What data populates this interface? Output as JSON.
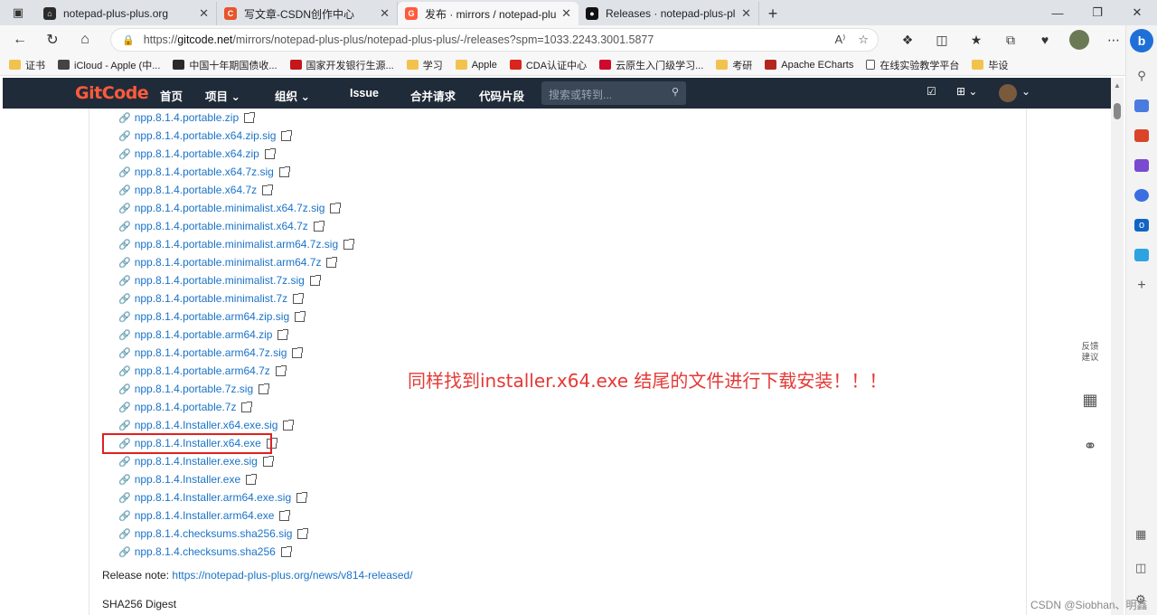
{
  "tabs": [
    {
      "title": "notepad-plus-plus.org",
      "color": "#2b2b2b",
      "glyph": "⌂"
    },
    {
      "title": "写文章-CSDN创作中心",
      "color": "#e8542a",
      "glyph": "C"
    },
    {
      "title": "发布 · mirrors / notepad-plus-plus",
      "color": "#ff5a3c",
      "glyph": "G"
    },
    {
      "title": "Releases · notepad-plus-plus/no",
      "color": "#111111",
      "glyph": "●"
    }
  ],
  "address": {
    "prefix": "https://",
    "host": "gitcode.net",
    "path": "/mirrors/notepad-plus-plus/notepad-plus-plus/-/releases?spm=1033.2243.3001.5877"
  },
  "bookmarks": [
    {
      "label": "证书",
      "kind": "folder",
      "color": "#f2c24f"
    },
    {
      "label": "iCloud - Apple (中...",
      "kind": "apple-icon",
      "color": "#444444"
    },
    {
      "label": "中国十年期国债收...",
      "kind": "site",
      "color": "#2a2a2a"
    },
    {
      "label": "国家开发银行生源...",
      "kind": "site",
      "color": "#c4161c"
    },
    {
      "label": "学习",
      "kind": "folder",
      "color": "#f2c24f"
    },
    {
      "label": "Apple",
      "kind": "folder",
      "color": "#f2c24f"
    },
    {
      "label": "CDA认证中心",
      "kind": "site",
      "color": "#d9251c"
    },
    {
      "label": "云原生入门级学习...",
      "kind": "site",
      "color": "#cf0a2c"
    },
    {
      "label": "考研",
      "kind": "folder",
      "color": "#f2c24f"
    },
    {
      "label": "Apache ECharts",
      "kind": "site",
      "color": "#b3261e"
    },
    {
      "label": "在线实验教学平台",
      "kind": "page",
      "color": "#ffffff"
    },
    {
      "label": "毕设",
      "kind": "folder",
      "color": "#f2c24f"
    }
  ],
  "gitcode": {
    "logo": "GitCode",
    "nav": {
      "home": "首页",
      "projects": "项目",
      "groups": "组织",
      "issue": "Issue",
      "merge": "合并请求",
      "snippets": "代码片段"
    },
    "search_placeholder": "搜索或转到..."
  },
  "files": [
    "npp.8.1.4.portable.zip",
    "npp.8.1.4.portable.x64.zip.sig",
    "npp.8.1.4.portable.x64.zip",
    "npp.8.1.4.portable.x64.7z.sig",
    "npp.8.1.4.portable.x64.7z",
    "npp.8.1.4.portable.minimalist.x64.7z.sig",
    "npp.8.1.4.portable.minimalist.x64.7z",
    "npp.8.1.4.portable.minimalist.arm64.7z.sig",
    "npp.8.1.4.portable.minimalist.arm64.7z",
    "npp.8.1.4.portable.minimalist.7z.sig",
    "npp.8.1.4.portable.minimalist.7z",
    "npp.8.1.4.portable.arm64.zip.sig",
    "npp.8.1.4.portable.arm64.zip",
    "npp.8.1.4.portable.arm64.7z.sig",
    "npp.8.1.4.portable.arm64.7z",
    "npp.8.1.4.portable.7z.sig",
    "npp.8.1.4.portable.7z",
    "npp.8.1.4.Installer.x64.exe.sig",
    "npp.8.1.4.Installer.x64.exe",
    "npp.8.1.4.Installer.exe.sig",
    "npp.8.1.4.Installer.exe",
    "npp.8.1.4.Installer.arm64.exe.sig",
    "npp.8.1.4.Installer.arm64.exe",
    "npp.8.1.4.checksums.sha256.sig",
    "npp.8.1.4.checksums.sha256"
  ],
  "release_note": {
    "label": "Release note: ",
    "url": "https://notepad-plus-plus.org/news/v814-released/"
  },
  "digest_label": "SHA256 Digest",
  "annotation": "同样找到installer.x64.exe 结尾的文件进行下载安装！！！",
  "feedback": {
    "line1": "反馈",
    "line2": "建议"
  },
  "watermark": "CSDN @Siobhan、明鑫",
  "colors": {
    "annotation": "#e53935",
    "link": "#1a73c8",
    "navbar": "#1f2b38",
    "highlight": "#e02020"
  }
}
